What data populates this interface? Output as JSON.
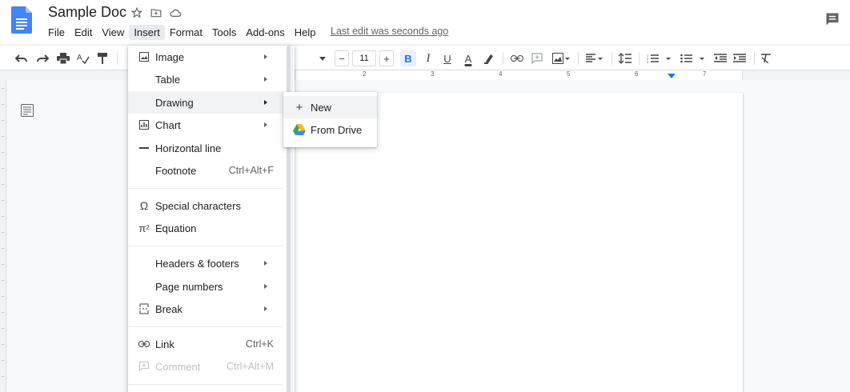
{
  "doc": {
    "title": "Sample Doc",
    "last_edit": "Last edit was seconds ago"
  },
  "menubar": [
    "File",
    "Edit",
    "View",
    "Insert",
    "Format",
    "Tools",
    "Add-ons",
    "Help"
  ],
  "toolbar": {
    "font_size": "11",
    "minus": "−",
    "plus": "+",
    "bold": "B",
    "italic": "I",
    "underline": "U",
    "text_color": "A"
  },
  "ruler": {
    "numbers": [
      "2",
      "3",
      "4",
      "5",
      "6",
      "7"
    ]
  },
  "insert_menu": {
    "items": [
      {
        "label": "Image",
        "icon": "image-icon",
        "submenu": true
      },
      {
        "label": "Table",
        "icon": "",
        "submenu": true
      },
      {
        "label": "Drawing",
        "icon": "",
        "submenu": true,
        "hover": true
      },
      {
        "label": "Chart",
        "icon": "chart-icon",
        "submenu": true
      },
      {
        "label": "Horizontal line",
        "icon": "horizontal-line-icon"
      },
      {
        "label": "Footnote",
        "icon": "",
        "shortcut": "Ctrl+Alt+F"
      },
      {
        "label": "Special characters",
        "icon": "omega-icon"
      },
      {
        "label": "Equation",
        "icon": "pi-icon"
      },
      {
        "label": "Headers & footers",
        "icon": "",
        "submenu": true
      },
      {
        "label": "Page numbers",
        "icon": "",
        "submenu": true
      },
      {
        "label": "Break",
        "icon": "page-break-icon",
        "submenu": true
      },
      {
        "label": "Link",
        "icon": "link-icon",
        "shortcut": "Ctrl+K"
      },
      {
        "label": "Comment",
        "icon": "comment-icon",
        "shortcut": "Ctrl+Alt+M",
        "disabled": true
      }
    ]
  },
  "drawing_submenu": {
    "items": [
      {
        "label": "New",
        "icon": "plus-icon"
      },
      {
        "label": "From Drive",
        "icon": "google-drive-icon"
      }
    ]
  },
  "colors": {
    "accent": "#1a73e8",
    "doc_blue": "#4285f4"
  }
}
